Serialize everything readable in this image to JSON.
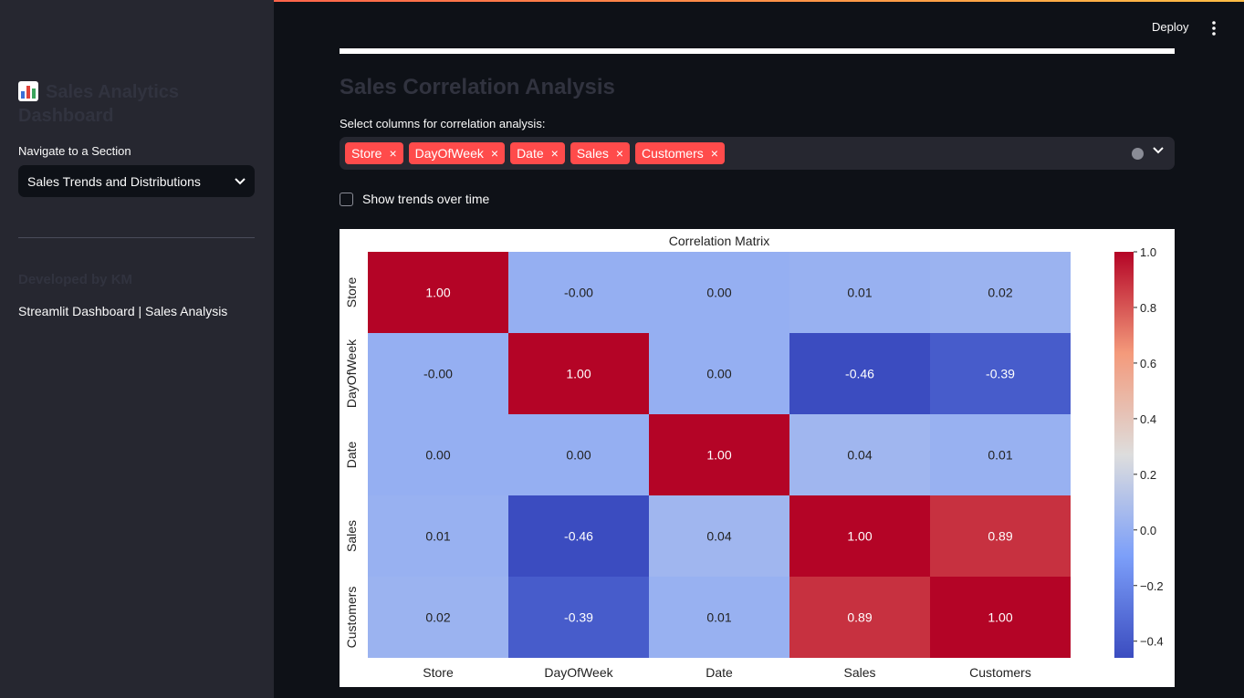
{
  "sidebar": {
    "title": "Sales Analytics Dashboard",
    "nav_label": "Navigate to a Section",
    "nav_selected": "Sales Trends and Distributions",
    "developer": "Developed by KM",
    "footer": "Streamlit Dashboard | Sales Analysis"
  },
  "header": {
    "deploy_label": "Deploy"
  },
  "main": {
    "title": "Sales Correlation Analysis",
    "multiselect_label": "Select columns for correlation analysis:",
    "selected_columns": [
      "Store",
      "DayOfWeek",
      "Date",
      "Sales",
      "Customers"
    ],
    "checkbox_label": "Show trends over time",
    "checkbox_checked": false,
    "chip_color": "#ff4b4b"
  },
  "chart_data": {
    "type": "heatmap",
    "title": "Correlation Matrix",
    "x": [
      "Store",
      "DayOfWeek",
      "Date",
      "Sales",
      "Customers"
    ],
    "y": [
      "Store",
      "DayOfWeek",
      "Date",
      "Sales",
      "Customers"
    ],
    "values": [
      [
        1.0,
        -0.0,
        0.0,
        0.01,
        0.02
      ],
      [
        -0.0,
        1.0,
        0.0,
        -0.46,
        -0.39
      ],
      [
        0.0,
        0.0,
        1.0,
        0.04,
        0.01
      ],
      [
        0.01,
        -0.46,
        0.04,
        1.0,
        0.89
      ],
      [
        0.02,
        -0.39,
        0.01,
        0.89,
        1.0
      ]
    ],
    "labels": [
      [
        "1.00",
        "-0.00",
        "0.00",
        "0.01",
        "0.02"
      ],
      [
        "-0.00",
        "1.00",
        "0.00",
        "-0.46",
        "-0.39"
      ],
      [
        "0.00",
        "0.00",
        "1.00",
        "0.04",
        "0.01"
      ],
      [
        "0.01",
        "-0.46",
        "0.04",
        "1.00",
        "0.89"
      ],
      [
        "0.02",
        "-0.39",
        "0.01",
        "0.89",
        "1.00"
      ]
    ],
    "colormap": "coolwarm",
    "colorbar_range": [
      -0.46,
      1.0
    ],
    "colorbar_ticks": [
      1.0,
      0.8,
      0.6,
      0.4,
      0.2,
      0.0,
      -0.2,
      -0.4
    ],
    "colorbar_tick_labels": [
      "1.0",
      "0.8",
      "0.6",
      "0.4",
      "0.2",
      "0.0",
      "−0.2",
      "−0.4"
    ]
  }
}
